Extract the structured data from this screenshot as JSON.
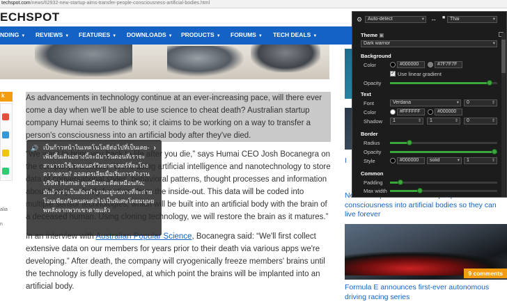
{
  "browser": {
    "url_prefix": "techspot.com",
    "url_rest": "/news/62932-new-startup-aims-transfer-people-consciousness-artificial-bodies.html"
  },
  "site": {
    "logo": "ECHSPOT",
    "nav": [
      {
        "label": "NDING",
        "caret": true
      },
      {
        "label": "REVIEWS",
        "caret": true
      },
      {
        "label": "FEATURES",
        "caret": true
      },
      {
        "label": "DOWNLOADS",
        "caret": true
      },
      {
        "label": "PRODUCTS",
        "caret": true
      },
      {
        "label": "FORUMS",
        "caret": true
      },
      {
        "label": "TECH DEALS",
        "caret": true
      }
    ],
    "caret_glyph": "▼"
  },
  "gutter": {
    "tag": "k",
    "text1": "alia",
    "text2": "n"
  },
  "article": {
    "p1": "As advancements in technology continue at an ever-increasing pace, will there ever come a day when we'll be able to use science to cheat death? Australian startup company Humai seems to think so; it claims to be working on a way to transfer a person's consciousness into an artificial body after they've died.",
    "p2": "“We want to bring you back to life after you die,” says Humai CEO Josh Bocanegra on the company's website. “We're using artificial intelligence and nanotechnology to store data of conversational styles, behavioral patterns, thought processes and information about how your body functions from the inside-out. This data will be coded into multiple sensor technologies, which will be built into an artificial body with the brain of a deceased human. Using cloning technology, we will restore the brain as it matures.”",
    "p3_pre": "In an interview with ",
    "p3_link": "Australian Popular Science",
    "p3_post": ", Bocanegra said: “We'll first collect extensive data on our members for years prior to their death via various apps we're developing.” After death, the company will cryogenically freeze members' brains until the technology is fully developed, at which point the brains will be implanted into an artificial body."
  },
  "popup": {
    "speaker_icon": "🔊",
    "next_icon": "›",
    "text": "เป็นก้าวหน้าในเทคโนโลยีต่อไปที่เป็นเคย-เพิ่มขึ้นเดินอย่างนี้จะมีมาวันตอนที่เราจะสามารถใช้เวทมนตร์วิทยาศาสตร์ที่จะโกงความตาย? ออสเตรเลียเมื่อเริ่มการทำงานบริษัท Humai ดูเหมือนจะคิดเหมือนกัน; มันอ้างว่าเป็นต้องทำงานอยู่บนทางที่จะถ่ายโอนเพียงกับคนคนต่อไปเป็นพิเศษโดยมนุษยพหลังจากพวกเขาตายแล้ว"
  },
  "sidebar": {
    "h1": "H",
    "h2": "I",
    "story1": "New startup aims to transfer people's consciousness into artificial bodies so they can live forever",
    "story2": "Formula E announces first-ever autonomous driving racing series",
    "comments": "9 comments"
  },
  "panel": {
    "source_lang": "Auto-detect",
    "swap_icon": "↔",
    "target_lang": "Thai",
    "theme_label": "Theme",
    "theme_value": "Dark warrior",
    "background_label": "Background",
    "color_label": "Color",
    "bg_color1": "#000000",
    "bg_color2": "#7F7F7F",
    "use_gradient": "Use linear gradient",
    "opacity_label": "Opacity",
    "bg_opacity": 0.93,
    "text_label": "Text",
    "font_label": "Font",
    "font_value": "Verdana",
    "font_size": "0",
    "text_color1": "#FFFFFF",
    "text_color2": "#000000",
    "shadow_label": "Shadow",
    "shadow1": "1",
    "shadow2": "1",
    "shadow3": "0",
    "border_label": "Border",
    "radius_label": "Radius",
    "radius_value": 0.18,
    "border_opacity_label": "Opacity",
    "border_opacity": 1.0,
    "style_label": "Style",
    "border_color": "#000000",
    "border_style": "solid",
    "border_width": "1",
    "common_label": "Common",
    "padding_label": "Padding",
    "padding_value": 0.1,
    "maxwidth_label": "Max width",
    "maxwidth_value": 0.28,
    "accent": "#3aa83a"
  }
}
